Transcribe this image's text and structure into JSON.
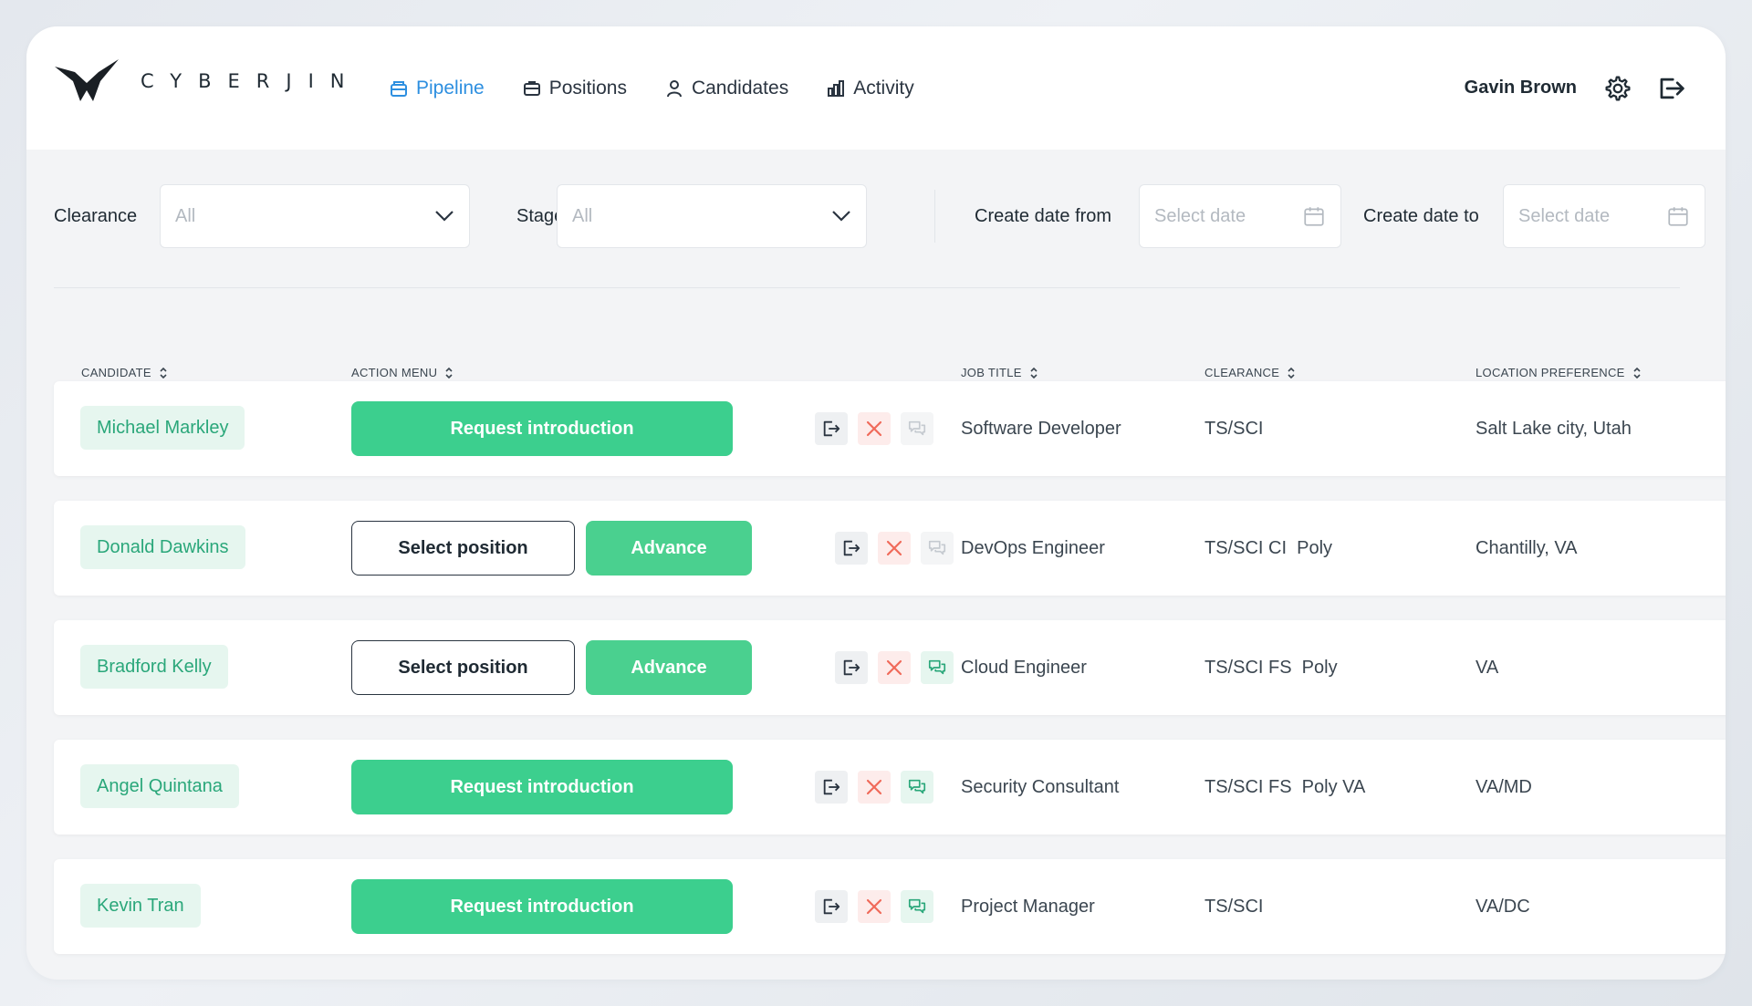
{
  "brand": {
    "name": "CYBERJIN"
  },
  "nav": {
    "items": [
      {
        "label": "Pipeline",
        "icon": "pipeline-icon",
        "active": true
      },
      {
        "label": "Positions",
        "icon": "briefcase-icon"
      },
      {
        "label": "Candidates",
        "icon": "user-icon"
      },
      {
        "label": "Activity",
        "icon": "bar-chart-icon"
      }
    ]
  },
  "user": {
    "name": "Gavin Brown"
  },
  "filters": {
    "clearance": {
      "label": "Clearance",
      "value": "All"
    },
    "stage": {
      "label": "Stage",
      "value": "All"
    },
    "date_from": {
      "label": "Create date from",
      "placeholder": "Select date"
    },
    "date_to": {
      "label": "Create date to",
      "placeholder": "Select date"
    }
  },
  "table": {
    "columns": {
      "candidate": "CANDIDATE",
      "action": "ACTION MENU",
      "job": "JOB TITLE",
      "clearance": "CLEARANCE",
      "location": "LOCATION PREFERENCE"
    },
    "rows": [
      {
        "candidate": "Michael Markley",
        "action": "request",
        "action_label": "Request introduction",
        "job": "Software Developer",
        "clearance": "TS/SCI",
        "location": "Salt Lake city, Utah",
        "chat_active": false
      },
      {
        "candidate": "Donald Dawkins",
        "action": "advance",
        "select_label": "Select position",
        "advance_label": "Advance",
        "job": "DevOps Engineer",
        "clearance": "TS/SCI CI  Poly",
        "location": "Chantilly, VA",
        "chat_active": false
      },
      {
        "candidate": "Bradford Kelly",
        "action": "advance",
        "select_label": "Select position",
        "advance_label": "Advance",
        "job": "Cloud Engineer",
        "clearance": "TS/SCI FS  Poly",
        "location": "VA",
        "chat_active": true
      },
      {
        "candidate": "Angel Quintana",
        "action": "request",
        "action_label": "Request introduction",
        "job": "Security Consultant",
        "clearance": "TS/SCI FS  Poly VA",
        "location": "VA/MD",
        "chat_active": true
      },
      {
        "candidate": "Kevin Tran",
        "action": "request",
        "action_label": "Request introduction",
        "job": "Project Manager",
        "clearance": "TS/SCI",
        "location": "VA/DC",
        "chat_active": true
      }
    ]
  },
  "colors": {
    "accent": "#3ccf8e",
    "nav_active": "#2d8fe0",
    "reject": "#f06a5a"
  }
}
